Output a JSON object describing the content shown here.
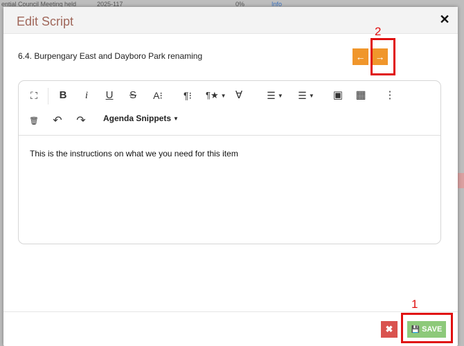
{
  "background": {
    "row_title": "ential Council Meeting held",
    "row_code": "2025-117",
    "row_percent": "0%",
    "row_status": "Info"
  },
  "modal": {
    "title": "Edit Script",
    "close_glyph": "✕",
    "item_title": "6.4. Burpengary East and Dayboro Park renaming",
    "prev_glyph": "←",
    "next_glyph": "→"
  },
  "toolbar": {
    "row1": [
      {
        "name": "fullscreen-icon",
        "glyph": "⛶"
      },
      {
        "name": "bold-icon",
        "glyph": "B"
      },
      {
        "name": "italic-icon",
        "glyph": "i"
      },
      {
        "name": "underline-icon",
        "glyph": "U"
      },
      {
        "name": "strikethrough-icon",
        "glyph": "S"
      },
      {
        "name": "font-size-icon",
        "glyph": "A⁝"
      },
      {
        "name": "paragraph-format-icon",
        "glyph": "¶⁝"
      },
      {
        "name": "paragraph-style-icon",
        "glyph": "¶★"
      },
      {
        "name": "clear-formatting-icon",
        "glyph": "Ɐ"
      },
      {
        "name": "ordered-list-icon",
        "glyph": "☰"
      },
      {
        "name": "unordered-list-icon",
        "glyph": "☰"
      },
      {
        "name": "insert-image-icon",
        "glyph": "▣"
      },
      {
        "name": "insert-table-icon",
        "glyph": "▦"
      },
      {
        "name": "more-options-icon",
        "glyph": "⋮"
      }
    ],
    "row2": [
      {
        "name": "trash-icon",
        "glyph": "🗑"
      },
      {
        "name": "undo-icon",
        "glyph": "↶"
      },
      {
        "name": "redo-icon",
        "glyph": "↷"
      }
    ],
    "snippets_label": "Agenda Snippets",
    "caret_glyph": "▼"
  },
  "editor": {
    "content": "This is the instructions on what we you need for this item"
  },
  "footer": {
    "delete_glyph": "✖",
    "save_icon": "💾",
    "save_label": "SAVE"
  },
  "annotations": {
    "label_1": "1",
    "label_2": "2"
  },
  "colors": {
    "title": "#a0675a",
    "nav_buttons": "#f0962b",
    "delete_button": "#d9534f",
    "save_button": "#8dc97a",
    "annotation": "#e01010"
  }
}
